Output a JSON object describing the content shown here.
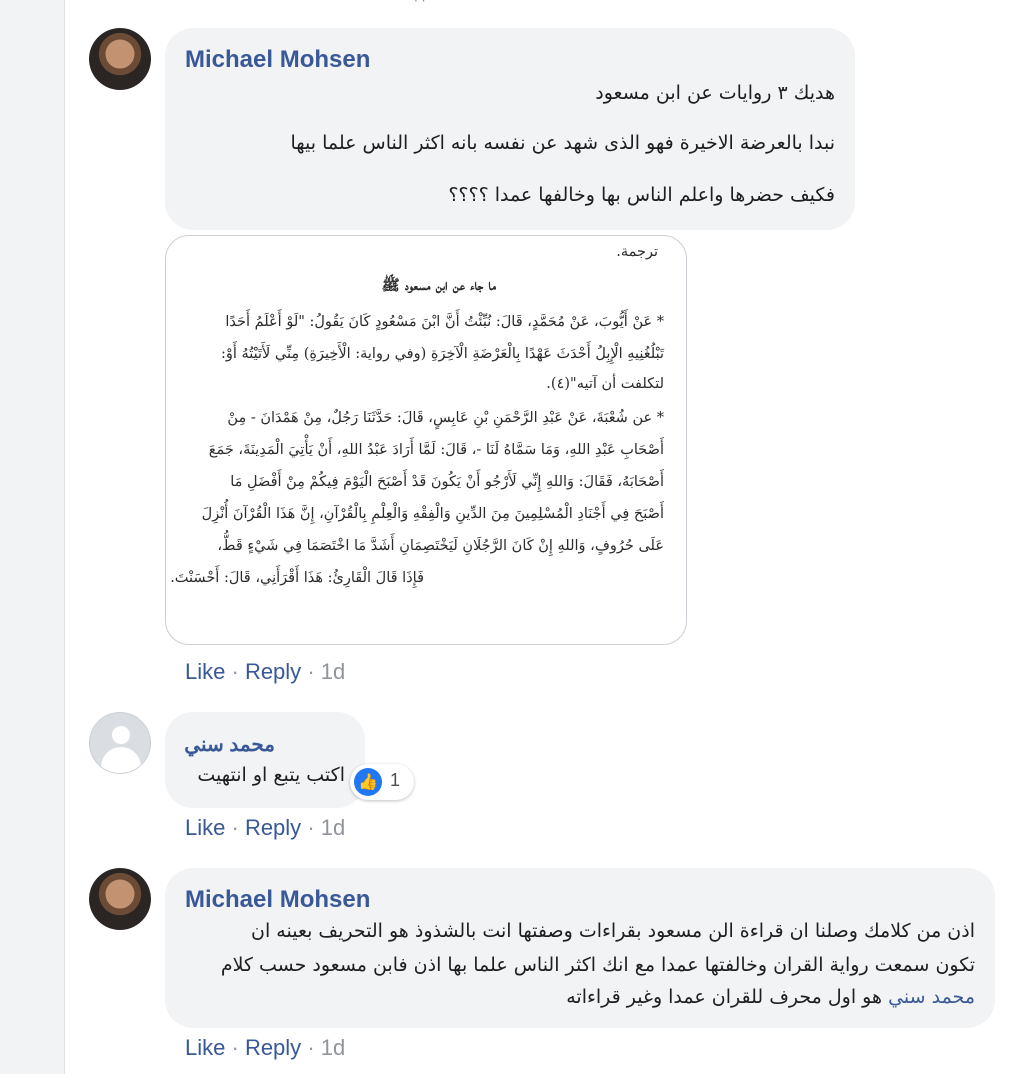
{
  "comments": [
    {
      "author": "Michael Mohsen",
      "lines": [
        "هديك ٣ روايات عن ابن مسعود",
        "نبدا بالعرضة الاخيرة فهو الذى شهد عن نفسه بانه اكثر الناس علما بيها",
        "فكيف حضرها واعلم الناس بها وخالفها عمدا ؟؟؟؟"
      ],
      "attachment": {
        "header": "ترجمة.",
        "title": "ما جاء عن ابن مسعود ﷺ",
        "lines": [
          "* عَنْ أَيُّوبَ، عَنْ مُحَمَّدٍ، قَالَ: نُبِّئْتُ أَنَّ ابْنَ مَسْعُودٍ كَانَ يَقُولُ: \"لَوْ أَعْلَمُ أَحَدًا",
          "تَبْلُغُنِيهِ الْإِبِلُ أَحْدَثَ عَهْدًا بِالْعَرْضَةِ الْآخِرَةِ (وفي رواية: الْأَخِيرَةِ) مِنِّي لَأَتَيْتُهُ أَوْ:",
          "لتكلفت أن آتيه\"(٤).",
          "* عن شُعْبَةَ، عَنْ عَبْدِ الرَّحْمَنِ بْنِ عَابِسٍ، قَالَ: حَدَّثَنَا رَجُلٌ، مِنْ هَمْدَانَ - مِنْ",
          "أَصْحَابِ عَبْدِ اللهِ، وَمَا سَمَّاهُ لَنَا -، قَالَ: لَمَّا أَرَادَ عَبْدُ اللهِ، أَنْ يَأْتِيَ الْمَدِينَةَ، جَمَعَ",
          "أَصْحَابَهُ، فَقَالَ: وَاللهِ إِنِّي لَأَرْجُو أَنْ يَكُونَ قَدْ أَصْبَحَ الْيَوْمَ فِيكُمْ مِنْ أَفْضَلِ مَا",
          "أَصْبَحَ فِي أَجْنَادِ الْمُسْلِمِينَ مِنَ الدِّينِ وَالْفِقْهِ وَالْعِلْمِ بِالْقُرْآنِ، إِنَّ هَذَا الْقُرْآنَ أُنْزِلَ",
          "عَلَى حُرُوفٍ، وَاللهِ إِنْ كَانَ الرَّجُلَانِ لَيَخْتَصِمَانِ أَشَدَّ مَا اخْتَصَمَا فِي شَيْءٍ قَطُّ،",
          "فَإِذَا قَالَ الْقَارِئُ: هَذَا أَقْرَأَنِي، قَالَ: أَحْسَنْتَ."
        ]
      },
      "actions": {
        "like": "Like",
        "reply": "Reply",
        "time": "1d",
        "sep": "·"
      }
    },
    {
      "author": "محمد سني",
      "lines": [
        "اكتب يتبع او انتهيت"
      ],
      "reaction": {
        "icon": "thumbs-up-icon",
        "count": "1"
      },
      "actions": {
        "like": "Like",
        "reply": "Reply",
        "time": "1d",
        "sep": "·"
      }
    },
    {
      "author": "Michael Mohsen",
      "lines": [
        "اذن من كلامك وصلنا ان قراءة الن مسعود بقراءات وصفتها انت بالشذوذ هو التحريف بعينه ان",
        "تكون سمعت رواية القران وخالفتها عمدا مع انك اكثر الناس علما بها اذن فابن مسعود حسب كلام"
      ],
      "mention": "محمد سني",
      "last_line": "هو اول محرف للقران عمدا وغير قراءاته",
      "actions": {
        "like": "Like",
        "reply": "Reply",
        "time": "1d",
        "sep": "·"
      }
    }
  ],
  "colors": {
    "link": "#385898",
    "bubble": "#f2f3f5",
    "like_blue": "#2078f4"
  }
}
